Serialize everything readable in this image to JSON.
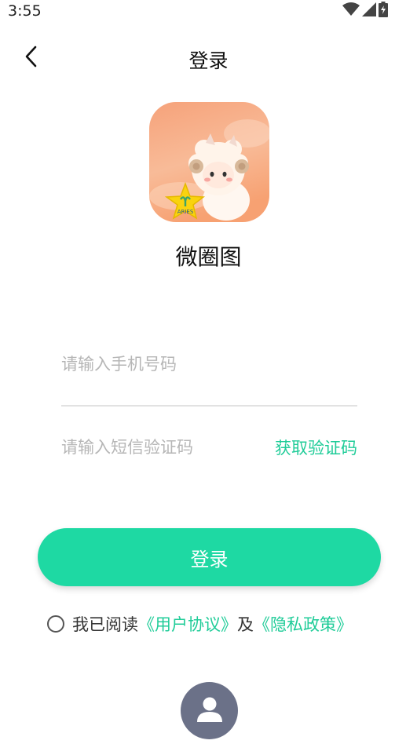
{
  "status_bar": {
    "time": "3:55",
    "icons": [
      "wifi-icon",
      "signal-icon",
      "battery-icon"
    ]
  },
  "nav": {
    "title": "登录",
    "back_icon": "chevron-left-icon"
  },
  "app": {
    "name": "微圈图",
    "logo_badge_text": "ARIES"
  },
  "form": {
    "phone_placeholder": "请输入手机号码",
    "phone_value": "",
    "code_placeholder": "请输入短信验证码",
    "code_value": "",
    "get_code_label": "获取验证码",
    "login_label": "登录"
  },
  "agreement": {
    "checked": false,
    "prefix": "我已阅读",
    "user_agreement": "《用户协议》",
    "conjunction": "及",
    "privacy_policy": "《隐私政策》"
  },
  "bottom": {
    "avatar_icon": "user-icon"
  },
  "colors": {
    "accent": "#1ed9a3",
    "link": "#1fcc98",
    "avatar_bg": "#6b7188"
  }
}
